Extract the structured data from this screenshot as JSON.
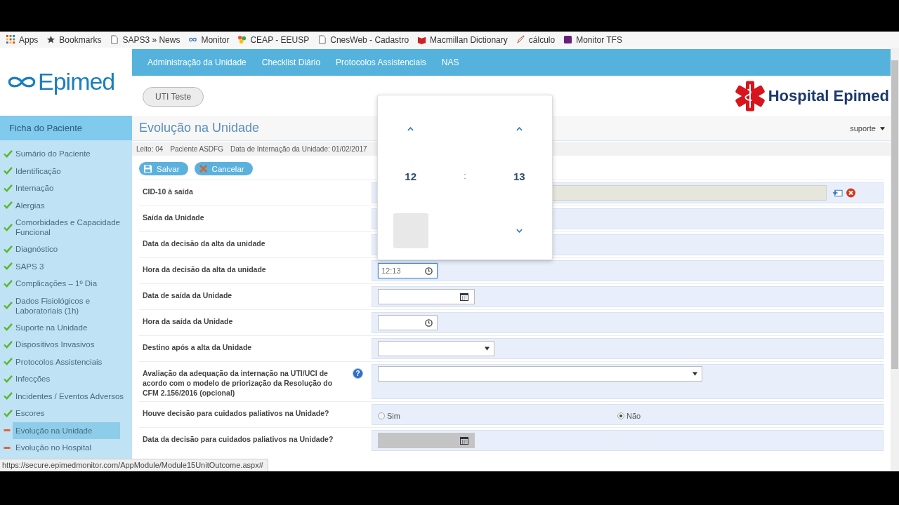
{
  "bookmarks": [
    {
      "label": "Apps",
      "kind": "apps"
    },
    {
      "label": "Bookmarks",
      "kind": "star"
    },
    {
      "label": "SAPS3 » News",
      "kind": "page"
    },
    {
      "label": "Monitor",
      "kind": "infinity"
    },
    {
      "label": "CEAP - EEUSP",
      "kind": "colorful"
    },
    {
      "label": "CnesWeb - Cadastro",
      "kind": "page"
    },
    {
      "label": "Macmillan Dictionary",
      "kind": "red"
    },
    {
      "label": "cálculo",
      "kind": "pen"
    },
    {
      "label": "Monitor TFS",
      "kind": "purple"
    }
  ],
  "logo": "Epimed",
  "nav": [
    "Administração da Unidade",
    "Checklist Diário",
    "Protocolos Assistenciais",
    "NAS"
  ],
  "unit_button": "UTI Teste",
  "hospital_logo": "Hospital Epimed",
  "sidebar": {
    "title": "Ficha do Paciente",
    "items": [
      {
        "label": "Sumário do Paciente",
        "kind": "done",
        "selected": false
      },
      {
        "label": "Identificação",
        "kind": "done",
        "selected": false
      },
      {
        "label": "Internação",
        "kind": "done",
        "selected": false
      },
      {
        "label": "Alergias",
        "kind": "done",
        "selected": false
      },
      {
        "label": "Comorbidades e Capacidade Funcional",
        "kind": "done",
        "selected": false
      },
      {
        "label": "Diagnóstico",
        "kind": "done",
        "selected": false
      },
      {
        "label": "SAPS 3",
        "kind": "done",
        "selected": false
      },
      {
        "label": "Complicações – 1º Dia",
        "kind": "done",
        "selected": false
      },
      {
        "label": "Dados Fisiológicos e Laboratoriais (1h)",
        "kind": "done",
        "selected": false
      },
      {
        "label": "Suporte na Unidade",
        "kind": "done",
        "selected": false
      },
      {
        "label": "Dispositivos Invasivos",
        "kind": "done",
        "selected": false
      },
      {
        "label": "Protocolos Assistenciais",
        "kind": "done",
        "selected": false
      },
      {
        "label": "Infecções",
        "kind": "done",
        "selected": false
      },
      {
        "label": "Incidentes / Eventos Adversos",
        "kind": "done",
        "selected": false
      },
      {
        "label": "Escores",
        "kind": "done",
        "selected": false
      },
      {
        "label": "Evolução na Unidade",
        "kind": "pending",
        "selected": true
      },
      {
        "label": "Evolução no Hospital",
        "kind": "pending",
        "selected": false
      }
    ]
  },
  "page_title": "Evolução na Unidade",
  "user_menu": "suporte",
  "info": [
    "Leito: 04",
    "Paciente ASDFG",
    "Data de Internação da Unidade: 01/02/2017"
  ],
  "buttons": [
    {
      "label": "Salvar",
      "kind": "save"
    },
    {
      "label": "Cancelar",
      "kind": "cancel"
    }
  ],
  "rows": [
    {
      "label": "CID-10 à saída",
      "kind": "lookup"
    },
    {
      "label": "Saída da Unidade",
      "kind": "empty"
    },
    {
      "label": "Data da decisão da alta da unidade",
      "kind": "empty"
    },
    {
      "label": "Hora da decisão da alta da unidade",
      "kind": "time",
      "value": "12:13",
      "focused": true
    },
    {
      "label": "Data de saída da Unidade",
      "kind": "date",
      "disabled": false
    },
    {
      "label": "Hora da saída da Unidade",
      "kind": "time",
      "focused": false
    },
    {
      "label": "Destino após a alta da Unidade",
      "kind": "select",
      "wide": false
    },
    {
      "label": "Avaliação da adequação da internação na UTI/UCI de acordo com o modelo de priorização da Resolução do CFM 2.156/2016 (opcional)",
      "kind": "select",
      "wide": true,
      "help": "?"
    },
    {
      "label": "Houve decisão para cuidados paliativos na Unidade?",
      "kind": "radio",
      "options": [
        {
          "label": "Sim",
          "selected": false
        },
        {
          "label": "Não",
          "selected": true
        }
      ]
    },
    {
      "label": "Data da decisão para cuidados paliativos na Unidade?",
      "kind": "date",
      "disabled": true
    }
  ],
  "time_picker": {
    "hours": "12",
    "separator": ":",
    "minutes": "13",
    "hour_down_hovered": true
  },
  "status_url": "https://secure.epimedmonitor.com/AppModule/Module15UnitOutcome.aspx#"
}
